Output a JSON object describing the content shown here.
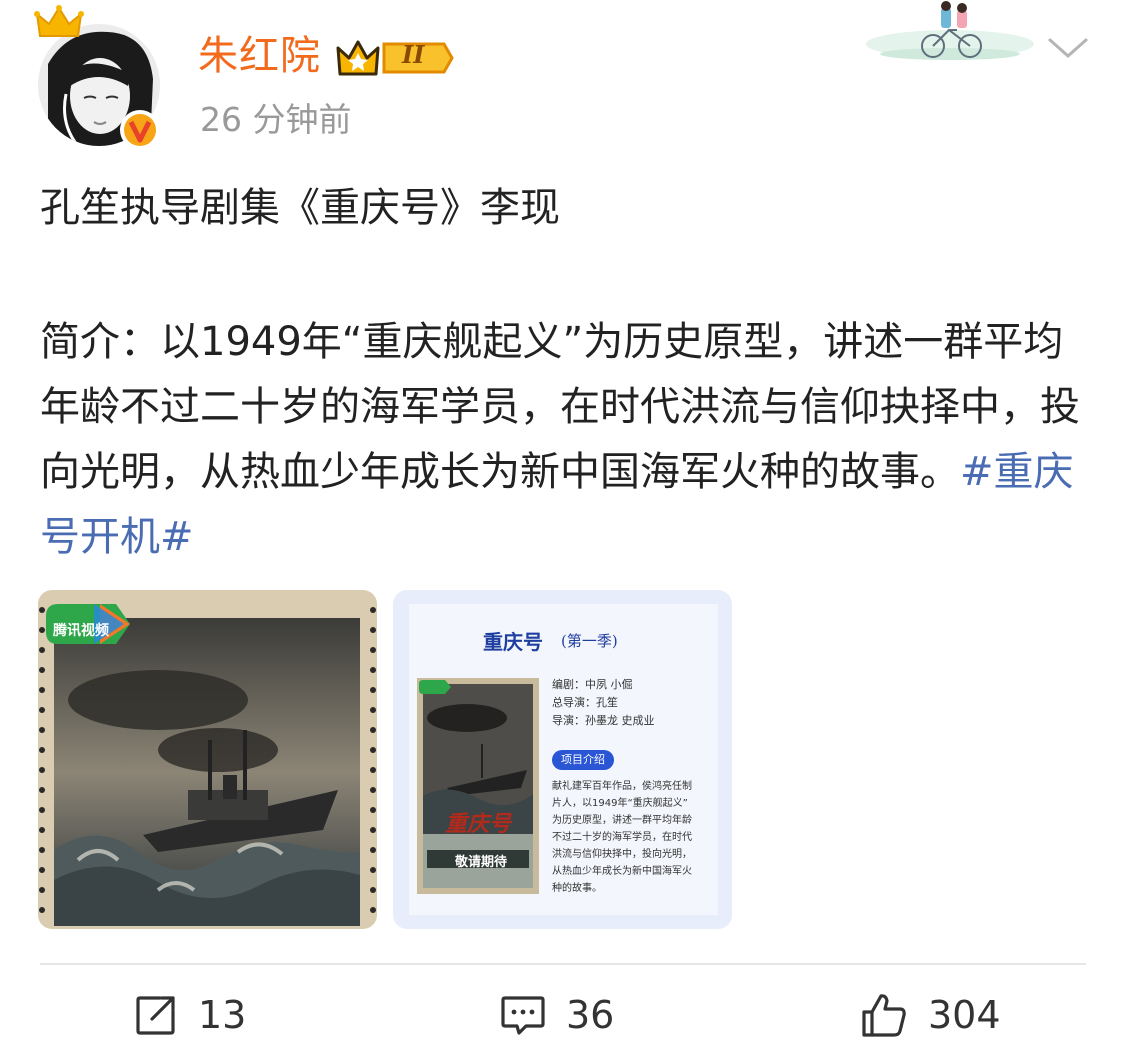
{
  "post": {
    "username": "朱红院",
    "rank_badge": "II",
    "time": "26 分钟前",
    "title": "孔笙执导剧集《重庆号》李现",
    "intro_text": "简介：以1949年“重庆舰起义”为历史原型，讲述一群平均年龄不过二十岁的海军学员，在时代洪流与信仰抉择中，投向光明，从热血少年成长为新中国海军火种的故事。",
    "hashtag": "#重庆号开机#"
  },
  "images": {
    "poster_logo": "腾讯视频",
    "card": {
      "title": "重庆号",
      "season": "(第一季)",
      "credits": [
        "编剧：中夙 小倔",
        "总导演：孔笙",
        "导演：孙墨龙 史成业"
      ],
      "section_label": "项目介绍",
      "description_lines": [
        "献礼建军百年作品，侯鸿亮任制",
        "片人，以1949年“重庆舰起义”",
        "为历史原型，讲述一群平均年龄",
        "不过二十岁的海军学员，在时代",
        "洪流与信仰抉择中，投向光明，",
        "从热血少年成长为新中国海军火",
        "种的故事。"
      ],
      "mini_poster_title": "重庆号",
      "mini_poster_tagline": "敬请期待"
    }
  },
  "actions": {
    "share_count": "13",
    "comment_count": "36",
    "like_count": "304"
  },
  "colors": {
    "username": "#f26b1d",
    "hashtag": "#4a6cb3",
    "card_title": "#1f3fa0",
    "section_badge": "#2a56d6"
  },
  "icons": [
    "crown-icon",
    "verified-icon",
    "chevron-down-icon",
    "share-icon",
    "comment-icon",
    "like-icon"
  ]
}
